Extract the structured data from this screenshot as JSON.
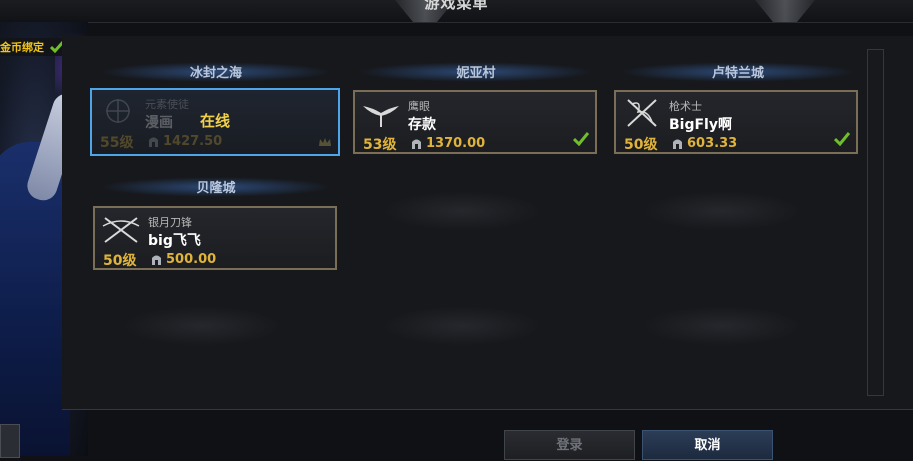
{
  "dialog": {
    "title": "游戏菜单"
  },
  "currency": {
    "label": "金币绑定"
  },
  "servers": [
    {
      "name": "冰封之海",
      "characters": [
        {
          "class": "元素使徒",
          "name": "漫画",
          "level": "55级",
          "power": "1427.50",
          "status": "在线",
          "selected": true
        }
      ]
    },
    {
      "name": "妮亚村",
      "characters": [
        {
          "class": "鹰眼",
          "name": "存款",
          "level": "53级",
          "power": "1370.00",
          "checked": true
        }
      ]
    },
    {
      "name": "卢特兰城",
      "characters": [
        {
          "class": "枪术士",
          "name": "BigFly啊",
          "level": "50级",
          "power": "603.33",
          "checked": true
        }
      ]
    },
    {
      "name": "贝隆城",
      "characters": [
        {
          "class": "银月刀锋",
          "name": "big飞飞",
          "level": "50级",
          "power": "500.00",
          "checked": false
        }
      ]
    }
  ],
  "buttons": {
    "login": "登录",
    "cancel": "取消"
  },
  "colors": {
    "accent": "#4ea6e8",
    "gold": "#e0b43b",
    "check": "#6fbf2a",
    "card_border": "#7a6e57"
  }
}
